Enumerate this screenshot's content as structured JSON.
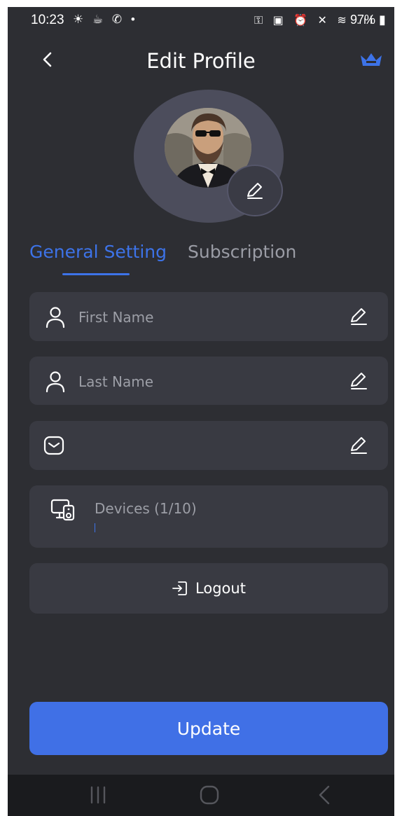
{
  "status_bar": {
    "time": "10:23",
    "left_icons": "☀ ☕ ✆ •",
    "right_icons": "⚿ ▣ ⏰ ✕ ≋ .ıl",
    "battery": "97%"
  },
  "header": {
    "title": "Edit Profile",
    "back_icon": "chevron-left-icon",
    "premium_icon": "crown-icon"
  },
  "tabs": {
    "general": "General Setting",
    "subscription": "Subscription",
    "active": "general"
  },
  "fields": {
    "first_name": {
      "label": "First Name",
      "icon": "user-icon"
    },
    "last_name": {
      "label": "Last Name",
      "icon": "user-icon"
    },
    "email": {
      "label": "",
      "icon": "mail-icon"
    },
    "devices": {
      "label": "Devices (1/10)",
      "icon": "devices-icon"
    }
  },
  "logout": {
    "label": "Logout",
    "icon": "logout-icon"
  },
  "update_button": {
    "label": "Update"
  },
  "colors": {
    "background": "#2d2e33",
    "card": "#393a42",
    "accent": "#4070e6",
    "muted_text": "#9c9ea6"
  }
}
